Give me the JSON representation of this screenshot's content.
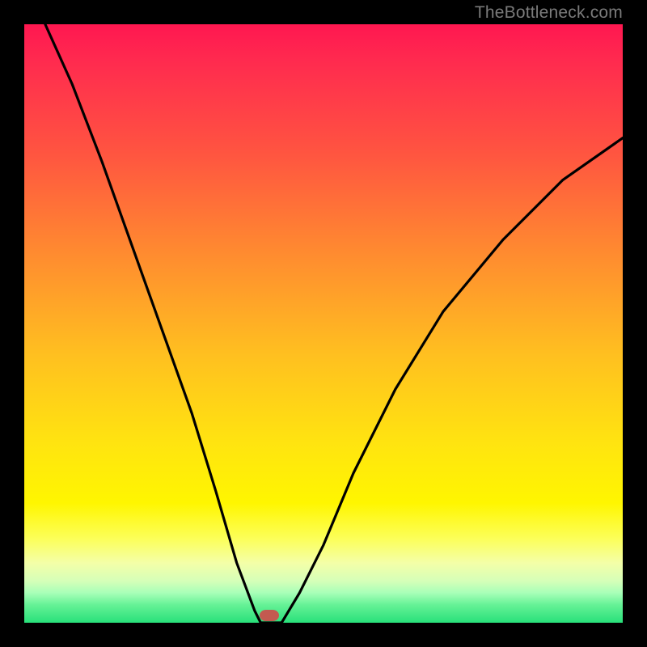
{
  "watermark": "TheBottleneck.com",
  "chart_data": {
    "type": "line",
    "title": "",
    "xlabel": "",
    "ylabel": "",
    "xlim": [
      0,
      1
    ],
    "ylim": [
      0,
      1
    ],
    "annotations": [
      {
        "name": "marker-oval",
        "x": 0.41,
        "y": 0.005
      }
    ],
    "series": [
      {
        "name": "left-branch",
        "x": [
          0.035,
          0.08,
          0.13,
          0.18,
          0.23,
          0.28,
          0.32,
          0.355,
          0.385,
          0.395
        ],
        "y": [
          1.0,
          0.9,
          0.77,
          0.63,
          0.49,
          0.35,
          0.22,
          0.1,
          0.02,
          0.0
        ]
      },
      {
        "name": "valley-floor",
        "x": [
          0.395,
          0.43
        ],
        "y": [
          0.0,
          0.0
        ]
      },
      {
        "name": "right-branch",
        "x": [
          0.43,
          0.46,
          0.5,
          0.55,
          0.62,
          0.7,
          0.8,
          0.9,
          1.0
        ],
        "y": [
          0.0,
          0.05,
          0.13,
          0.25,
          0.39,
          0.52,
          0.64,
          0.74,
          0.81
        ]
      }
    ],
    "gradient_stops": [
      {
        "pos": 0.0,
        "color": "#ff1750"
      },
      {
        "pos": 0.22,
        "color": "#ff5640"
      },
      {
        "pos": 0.55,
        "color": "#ffbf20"
      },
      {
        "pos": 0.8,
        "color": "#fff600"
      },
      {
        "pos": 0.93,
        "color": "#d6ffb8"
      },
      {
        "pos": 1.0,
        "color": "#28e07a"
      }
    ]
  }
}
